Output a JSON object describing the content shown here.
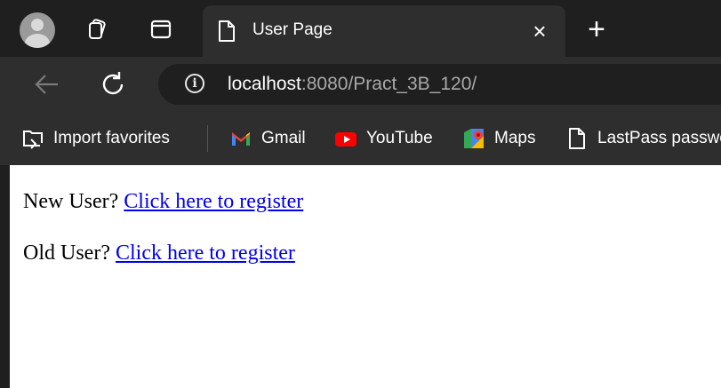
{
  "browser": {
    "tab": {
      "title": "User Page",
      "close_glyph": "×"
    },
    "new_tab_glyph": "+",
    "address": {
      "host": "localhost",
      "path": ":8080/Pract_3B_120/"
    },
    "bookmarks": [
      {
        "label": "Import favorites",
        "icon": "import-favorites-icon"
      },
      {
        "label": "Gmail",
        "icon": "gmail-icon"
      },
      {
        "label": "YouTube",
        "icon": "youtube-icon"
      },
      {
        "label": "Maps",
        "icon": "maps-icon"
      },
      {
        "label": "LastPass passwo",
        "icon": "document-icon"
      }
    ],
    "colors": {
      "chrome_dark": "#1f1f1f",
      "chrome_mid": "#2e2e2e",
      "link": "#0000ee"
    }
  },
  "page": {
    "new_user": {
      "prefix": "New User? ",
      "link_text": "Click here to register"
    },
    "old_user": {
      "prefix": "Old User? ",
      "link_text": "Click here to register"
    }
  }
}
